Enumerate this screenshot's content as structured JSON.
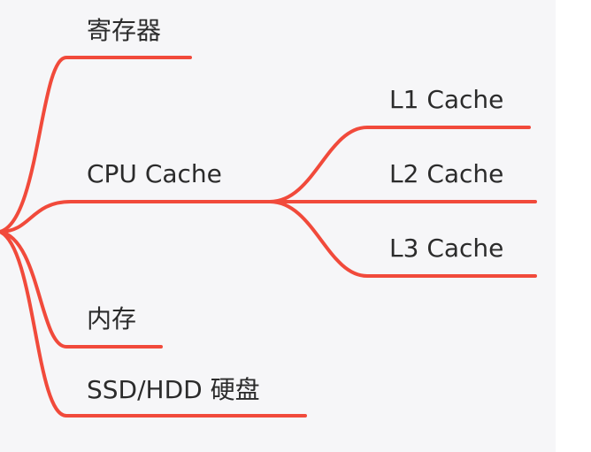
{
  "mindmap": {
    "colors": {
      "branch": "#f14a3b",
      "background": "#f6f6f8",
      "text": "#2b2b2b"
    },
    "nodes": {
      "register": "寄存器",
      "cpu_cache": "CPU Cache",
      "l1_cache": "L1 Cache",
      "l2_cache": "L2 Cache",
      "l3_cache": "L3 Cache",
      "memory": "内存",
      "disk": "SSD/HDD 硬盘"
    }
  }
}
